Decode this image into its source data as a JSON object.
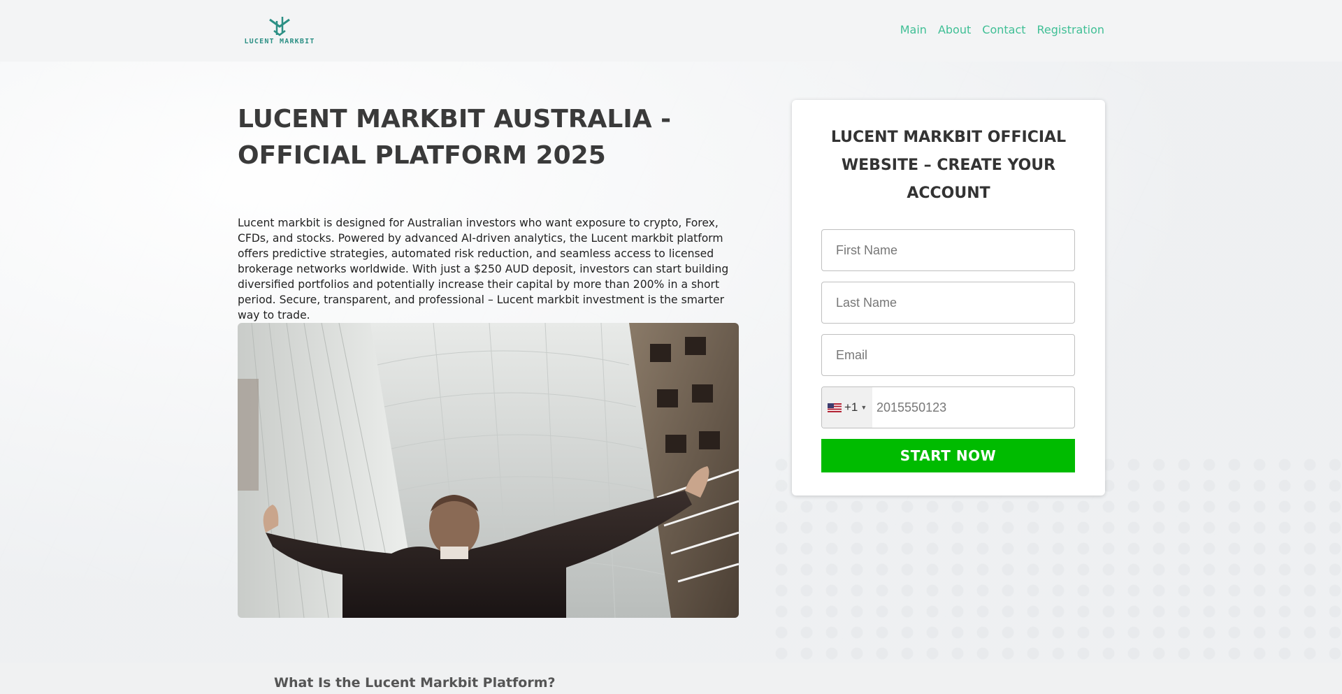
{
  "brand": {
    "logo_text": "LUCENT MARKBIT",
    "accent": "#2b8f84"
  },
  "nav": {
    "items": [
      "Main",
      "About",
      "Contact",
      "Registration"
    ],
    "color": "#3fbf95"
  },
  "hero": {
    "title": "LUCENT MARKBIT AUSTRALIA - OFFICIAL PLATFORM 2025",
    "intro": "Lucent markbit is designed for Australian investors who want exposure to crypto, Forex, CFDs, and stocks. Powered by advanced AI-driven analytics, the Lucent markbit platform offers predictive strategies, automated risk reduction, and seamless access to licensed brokerage networks worldwide. With just a $250 AUD deposit, investors can start building diversified portfolios and potentially increase their capital by more than 200% in a short period. Secure, transparent, and professional – Lucent markbit investment is the smarter way to trade."
  },
  "form": {
    "title": "LUCENT MARKBIT OFFICIAL WEBSITE – CREATE YOUR ACCOUNT",
    "first_name_placeholder": "First Name",
    "last_name_placeholder": "Last Name",
    "email_placeholder": "Email",
    "country_code": "+1",
    "country_flag_icon": "us-flag-icon",
    "phone_placeholder": "2015550123",
    "submit_label": "START NOW",
    "submit_color": "#00bb00"
  },
  "section": {
    "heading": "What Is the Lucent Markbit Platform?"
  }
}
